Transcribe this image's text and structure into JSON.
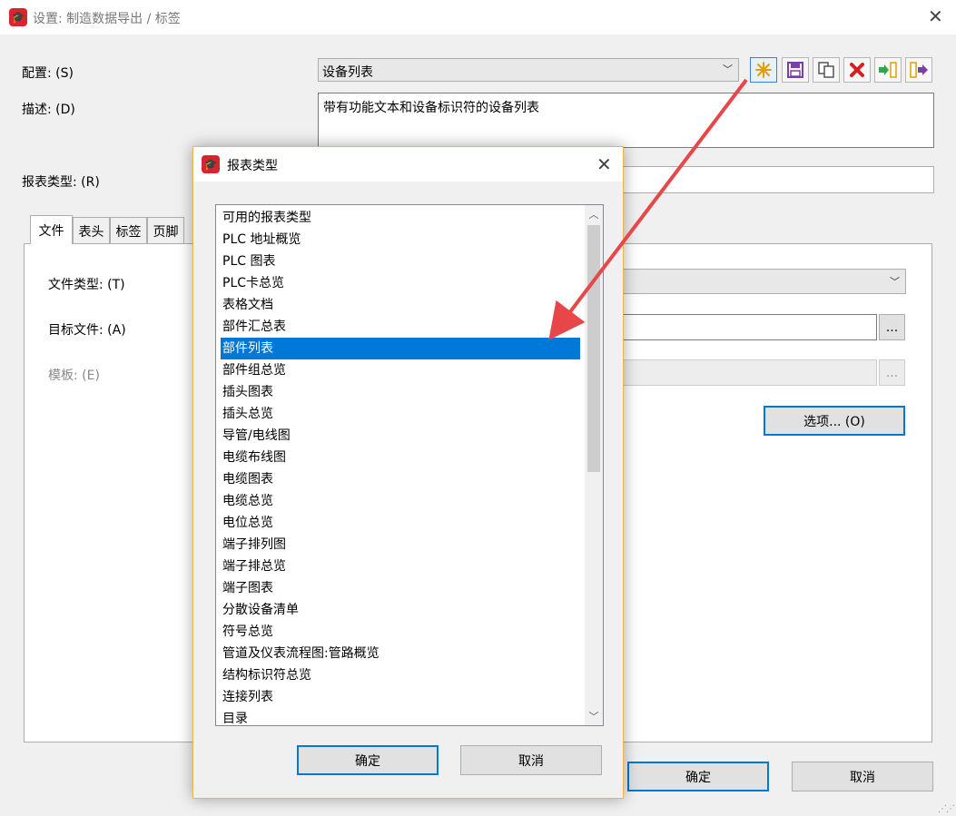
{
  "window": {
    "title": "设置: 制造数据导出 / 标签",
    "close_glyph": "✕"
  },
  "main": {
    "config_label": "配置: (S)",
    "config_value": "设备列表",
    "desc_label": "描述: (D)",
    "desc_value": "带有功能文本和设备标识符的设备列表",
    "report_type_label": "报表类型: (R)",
    "tabs": [
      {
        "label": "文件"
      },
      {
        "label": "表头"
      },
      {
        "label": "标签"
      },
      {
        "label": "页脚"
      }
    ],
    "file_type_label": "文件类型: (T)",
    "target_file_label": "目标文件: (A)",
    "template_label": "模板: (E)",
    "browse_glyph": "...",
    "options_button": "选项... (O)",
    "ok_button": "确定",
    "cancel_button": "取消"
  },
  "toolbar": {
    "icons": [
      "new-icon",
      "save-icon",
      "copy-icon",
      "delete-icon",
      "import-icon",
      "export-icon"
    ],
    "colors": {
      "new": "#e0a000",
      "save": "#7a3fa8",
      "delete": "#d42020",
      "import": "#2aa84a",
      "export": "#7a3fa8"
    }
  },
  "dialog": {
    "title": "报表类型",
    "close_glyph": "✕",
    "items": [
      "可用的报表类型",
      "PLC 地址概览",
      "PLC 图表",
      "PLC卡总览",
      "表格文档",
      "部件汇总表",
      "部件列表",
      "部件组总览",
      "插头图表",
      "插头总览",
      "导管/电线图",
      "电缆布线图",
      "电缆图表",
      "电缆总览",
      "电位总览",
      "端子排列图",
      "端子排总览",
      "端子图表",
      "分散设备清单",
      "符号总览",
      "管道及仪表流程图:管路概览",
      "结构标识符总览",
      "连接列表",
      "目录"
    ],
    "selected_item": "部件列表",
    "ok_button": "确定",
    "cancel_button": "取消"
  },
  "annotation": {
    "arrow_color": "#e8474a"
  }
}
